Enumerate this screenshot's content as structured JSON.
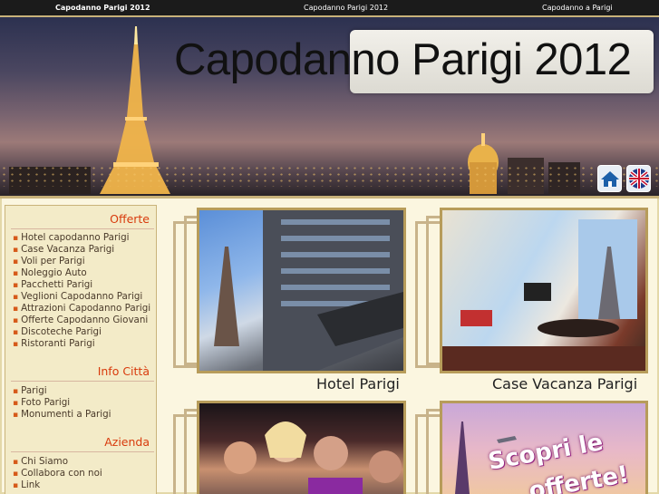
{
  "topbar": {
    "link1": "Capodanno Parigi 2012",
    "link2": "Capodanno Parigi 2012",
    "link3": "Capodanno a Parigi"
  },
  "header": {
    "title": "Capodanno Parigi 2012",
    "home_icon": "home-icon",
    "lang_icon": "uk-flag-icon"
  },
  "sidebar": {
    "sections": [
      {
        "heading": "Offerte",
        "items": [
          "Hotel capodanno Parigi",
          "Case Vacanza Parigi",
          "Voli per Parigi",
          "Noleggio Auto",
          "Pacchetti Parigi",
          "Veglioni Capodanno Parigi",
          "Attrazioni Capodanno Parigi",
          "Offerte Capodanno Giovani",
          "Discoteche Parigi",
          "Ristoranti Parigi"
        ]
      },
      {
        "heading": "Info Città",
        "items": [
          "Parigi",
          "Foto Parigi",
          "Monumenti a Parigi"
        ]
      },
      {
        "heading": "Azienda",
        "items": [
          "Chi Siamo",
          "Collabora con noi",
          "Link"
        ]
      }
    ]
  },
  "tiles": {
    "hotel": "Hotel Parigi",
    "case": "Case Vacanza Parigi",
    "offers_line1": "Scopri le",
    "offers_line2": "offerte!"
  },
  "colors": {
    "accent": "#d83a0c",
    "frame_gold": "#b79c5a",
    "topbar": "#1b1b1b"
  }
}
